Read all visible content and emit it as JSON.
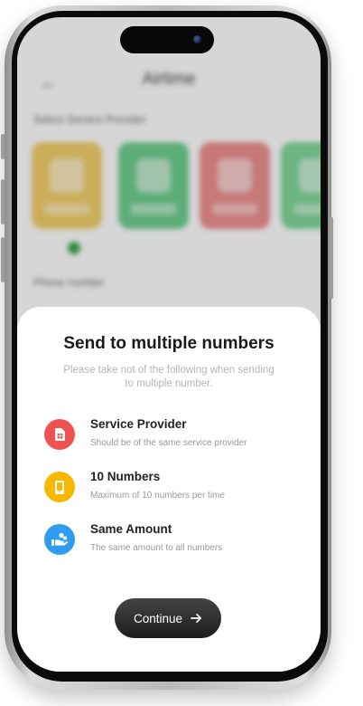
{
  "background_app": {
    "title": "Airtime",
    "section_label": "Select Service Provider",
    "section_label_2": "Phone number",
    "cards": [
      {
        "color": "#f2d06b"
      },
      {
        "color": "#6fcf8f"
      },
      {
        "color": "#ee8f8f"
      },
      {
        "color": "#7fd89a"
      }
    ]
  },
  "sheet": {
    "title": "Send to multiple numbers",
    "subtitle": "Please take not of the following when sending to multiple number.",
    "items": [
      {
        "title": "Service Provider",
        "description": "Should be of the same service provider",
        "icon": "sim-card-icon",
        "color": "#f05252"
      },
      {
        "title": "10 Numbers",
        "description": "Maximum of 10 numbers per time",
        "icon": "phone-icon",
        "color": "#f8b800"
      },
      {
        "title": "Same Amount",
        "description": "The same amount to all numbers",
        "icon": "hand-coins-icon",
        "color": "#2f9cf0"
      }
    ],
    "continue_label": "Continue"
  }
}
